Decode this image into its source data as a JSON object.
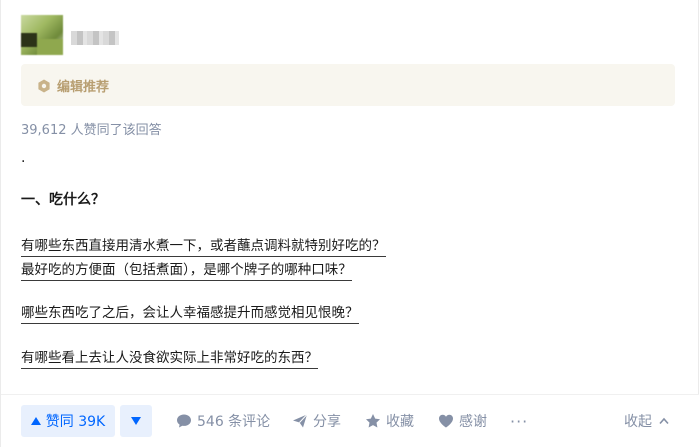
{
  "author": {
    "avatar_icon": "avatar-image",
    "name_hidden": true
  },
  "badge": {
    "icon": "editor-recommend-icon",
    "label": "编辑推荐",
    "color": "#b89f72"
  },
  "votes_summary": "39,612 人赞同了该回答",
  "answer": {
    "dot": "·",
    "heading": "一、吃什么？",
    "links": [
      "有哪些东西直接用清水煮一下，或者蘸点调料就特别好吃的？",
      "最好吃的方便面（包括煮面），是哪个牌子的哪种口味？",
      "哪些东西吃了之后，会让人幸福感提升而感觉相见恨晚？",
      "有哪些看上去让人没食欲实际上非常好吃的东西？"
    ]
  },
  "actions": {
    "upvote": "赞同 39K",
    "downvote_icon": "triangle-down-icon",
    "comments": "546 条评论",
    "share": "分享",
    "favorite": "收藏",
    "thanks": "感谢",
    "more": "···",
    "collapse": "收起",
    "accent_color": "#0066ff",
    "muted_color": "#8590a6"
  }
}
